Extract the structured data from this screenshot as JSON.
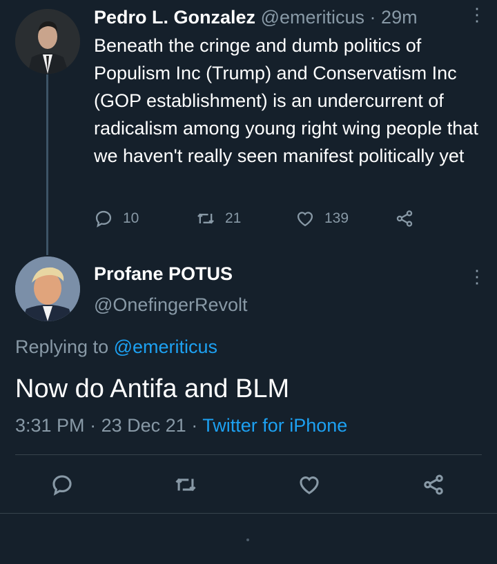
{
  "parent_tweet": {
    "name": "Pedro L. Gonzalez",
    "handle": "@emeriticus",
    "separator": "·",
    "time": "29m",
    "text": "Beneath the cringe and dumb politics of Populism Inc (Trump) and Conservatism Inc (GOP establishment) is an undercurrent of radicalism among young right wing people that we haven't really seen manifest politically yet",
    "replies": "10",
    "retweets": "21",
    "likes": "139"
  },
  "main_tweet": {
    "name": "Profane POTUS",
    "handle": "@OnefingerRevolt",
    "replying_prefix": "Replying to",
    "replying_to": "@emeriticus",
    "text": "Now do Antifa and BLM",
    "time": "3:31 PM",
    "separator1": "·",
    "date": "23 Dec 21",
    "separator2": "·",
    "source": "Twitter for iPhone"
  },
  "menu_glyph": "⋮",
  "icons": [
    "reply-icon",
    "retweet-icon",
    "like-icon",
    "share-icon",
    "more-icon"
  ],
  "colors": {
    "background": "#15202b",
    "secondary_text": "#8899a6",
    "link": "#1da1f2",
    "divider": "#38444d"
  }
}
